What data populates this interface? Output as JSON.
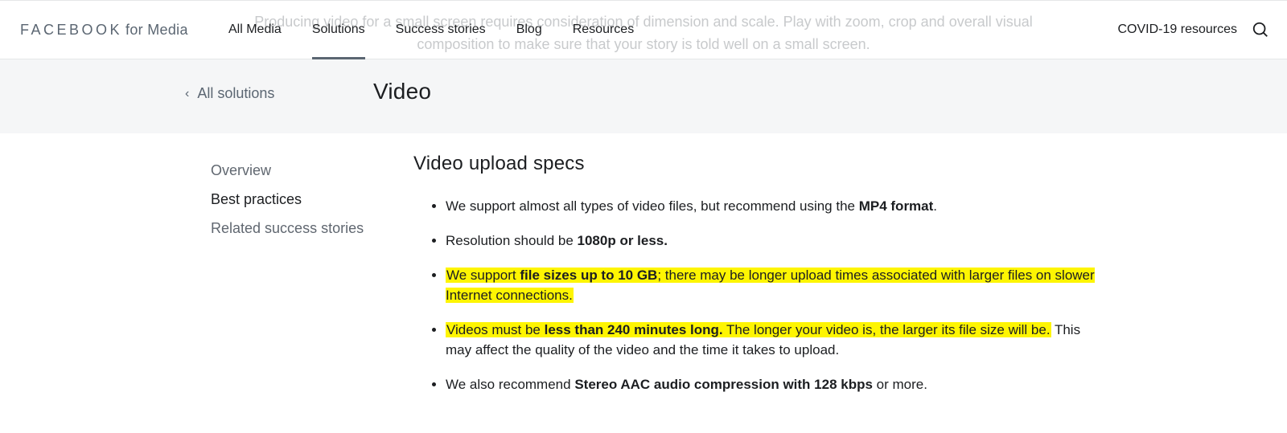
{
  "brand": {
    "main": "FACEBOOK",
    "sub": "for Media"
  },
  "nav": {
    "items": [
      {
        "label": "All Media"
      },
      {
        "label": "Solutions"
      },
      {
        "label": "Success stories"
      },
      {
        "label": "Blog"
      },
      {
        "label": "Resources"
      }
    ],
    "covid": "COVID-19 resources"
  },
  "ghost": "Producing video for a small screen requires consideration of dimension and scale. Play with zoom, crop and overall visual composition to make sure that your story is told well on a small screen.",
  "breadcrumb": {
    "back": "All solutions",
    "title": "Video"
  },
  "sidebar": {
    "items": [
      {
        "label": "Overview"
      },
      {
        "label": "Best practices"
      },
      {
        "label": "Related success stories"
      }
    ]
  },
  "section": {
    "title": "Video upload specs",
    "bullets": {
      "b1_a": "We support almost all types of video files, but recommend using the ",
      "b1_b": "MP4 format",
      "b1_c": ".",
      "b2_a": "Resolution should be ",
      "b2_b": "1080p or less.",
      "b3_a": "We support ",
      "b3_b": "file sizes up to 10 GB",
      "b3_c": "; there may be longer upload times associated with larger files on slower Internet connections.",
      "b4_a": "Videos must be ",
      "b4_b": "less than 240 minutes long.",
      "b4_c": " The longer your video is, the larger its file size will be.",
      "b4_d": " This may affect the quality of the video and the time it takes to upload.",
      "b5_a": "We also recommend ",
      "b5_b": "Stereo AAC audio compression with 128 kbps",
      "b5_c": " or more."
    }
  }
}
